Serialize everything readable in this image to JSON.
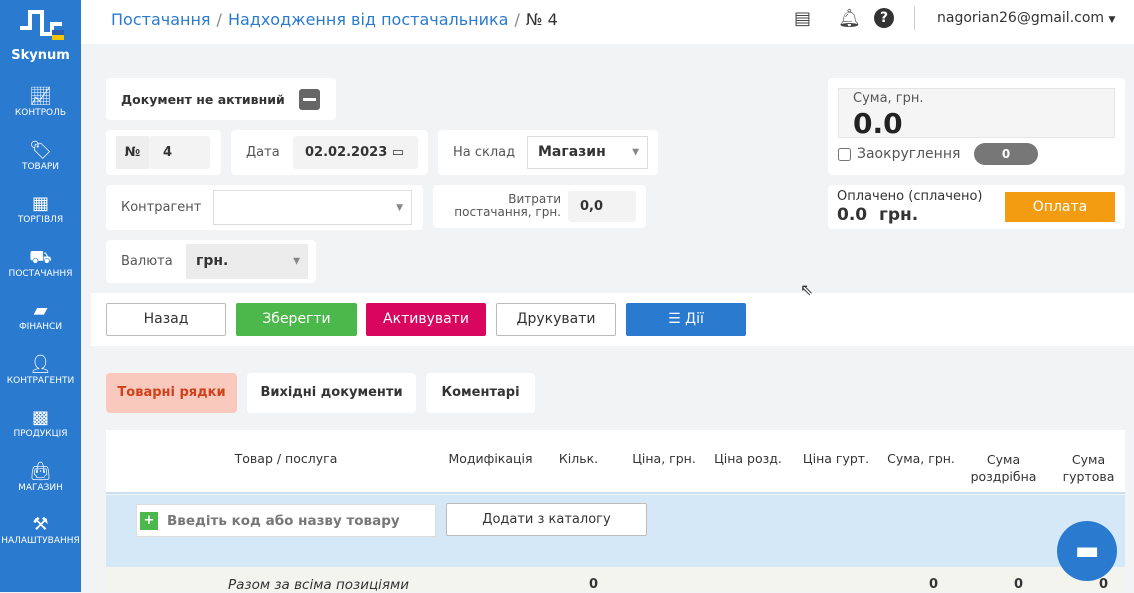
{
  "sidebar": {
    "brand": "Skynum",
    "items": [
      {
        "label": "КОНТРОЛЬ",
        "icon": "chart-up-icon"
      },
      {
        "label": "ТОВАРИ",
        "icon": "tag-icon"
      },
      {
        "label": "ТОРГІВЛЯ",
        "icon": "cash-register-icon"
      },
      {
        "label": "ПОСТАЧАННЯ",
        "icon": "truck-icon"
      },
      {
        "label": "ФІНАНСИ",
        "icon": "wallet-icon"
      },
      {
        "label": "КОНТРАГЕНТИ",
        "icon": "person-icon"
      },
      {
        "label": "ПРОДУКЦІЯ",
        "icon": "factory-icon"
      },
      {
        "label": "МАГАЗИН",
        "icon": "shop-bag-icon"
      },
      {
        "label": "НАЛАШТУВАННЯ",
        "icon": "hammer-icon"
      }
    ]
  },
  "header": {
    "breadcrumb": [
      "Постачання",
      "Надходження від постачальника",
      "№ 4"
    ],
    "user": "nagorian26@gmail.com"
  },
  "form": {
    "status": "Документ не активний",
    "number_label": "№",
    "number": "4",
    "date_label": "Дата",
    "date": "02.02.2023",
    "warehouse_label": "На склад",
    "warehouse": "Магазин",
    "counterparty_label": "Контрагент",
    "counterparty": "",
    "costs_label_1": "Витрати",
    "costs_label_2": "постачання, грн.",
    "costs": "0,0",
    "currency_label": "Валюта",
    "currency": "грн."
  },
  "summary": {
    "sum_label": "Сума, грн.",
    "sum": "0.0",
    "rounding_label": "Заокруглення",
    "rounding": "0",
    "paid_label": "Оплачено (сплачено)",
    "paid": "0.0  грн.",
    "pay_button": "Оплата"
  },
  "actions": {
    "back": "Назад",
    "save": "Зберегти",
    "activate": "Активувати",
    "print": "Друкувати",
    "actions": "Дії"
  },
  "tabs": [
    "Товарні рядки",
    "Вихідні документи",
    "Коментарі"
  ],
  "table": {
    "columns": [
      "Товар / послуга",
      "Модифікація",
      "Кільк.",
      "Ціна, грн.",
      "Ціна розд.",
      "Ціна гурт.",
      "Сума, грн.",
      "Сума роздрібна",
      "Сума гуртова"
    ],
    "search_placeholder": "Введіть код або назву товару",
    "add_catalog": "Додати з каталогу",
    "total_label": "Разом за всіма позиціями",
    "total_qty": "0",
    "total_sum": "0",
    "total_retail": "0",
    "total_wholesale": "0"
  }
}
